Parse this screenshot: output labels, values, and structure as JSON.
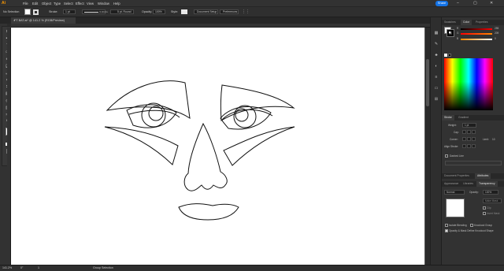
{
  "app": {
    "logo_text": "Ai"
  },
  "menu": [
    "File",
    "Edit",
    "Object",
    "Type",
    "Select",
    "Effect",
    "View",
    "Window",
    "Help"
  ],
  "share_label": "Share",
  "control_bar": {
    "selection": "No Selection",
    "stroke_label": "Stroke:",
    "stroke_value": "1 pt",
    "profile_label": "Uniform",
    "brush_label": "5 pt. Round",
    "opacity_label": "Opacity:",
    "opacity_value": "100%",
    "style_label": "Style:",
    "doc_setup": "Document Setup",
    "preferences": "Preferences"
  },
  "document_tab": {
    "title": "FT BAT.ai* @ 141.2 % (RGB/Preview)",
    "close": "×"
  },
  "status": {
    "zoom": "141.2%",
    "rotation": "0°",
    "artboard": "1",
    "mode": "Group Selection"
  },
  "panels": {
    "top_tabs": [
      "Swatches",
      "Color",
      "Properties"
    ],
    "active_top_tab": "Color",
    "color": {
      "r_label": "R",
      "r_value": "255",
      "g_label": "G",
      "g_value": "209",
      "b_label": "B",
      "b_value": "0",
      "hex_prefix": "#"
    },
    "stroke_tabs": [
      "Stroke",
      "Gradient"
    ],
    "stroke": {
      "weight_label": "Weight:",
      "weight_value": "1 pt",
      "cap_label": "Cap:",
      "corner_label": "Corner:",
      "limit_label": "Limit:",
      "limit_value": "10",
      "align_label": "Align Stroke:",
      "dashed_label": "Dashed Line"
    },
    "mid_tabs": [
      "Appearance",
      "Libraries"
    ],
    "mid_tabs_row2": [
      "Document Properties",
      "Attributes"
    ],
    "trans_tabs": [
      "Appearance",
      "Libraries",
      "Transparency"
    ],
    "transparency": {
      "mode": "Normal",
      "opacity_label": "Opacity:",
      "opacity_value": "100%",
      "make_mask": "Make Mask",
      "clip": "Clip",
      "invert": "Invert Mask",
      "isolate": "Isolate Blending",
      "knockout": "Knockout Group",
      "opacity_mask": "Opacity & Mask Define Knockout Shape"
    }
  },
  "tools": [
    "selection-tool",
    "direct-selection-tool",
    "pen-tool",
    "curvature-tool",
    "type-tool",
    "line-tool",
    "rectangle-tool",
    "paintbrush-tool",
    "shaper-tool",
    "pencil-tool",
    "eraser-tool",
    "rotate-tool",
    "scale-tool",
    "width-tool",
    "free-transform-tool",
    "shape-builder-tool",
    "perspective-tool",
    "mesh-tool",
    "gradient-tool",
    "eyedropper-tool",
    "blend-tool",
    "symbol-sprayer-tool",
    "column-graph-tool",
    "artboard-tool",
    "slice-tool",
    "hand-tool",
    "zoom-tool"
  ],
  "colors": {
    "fill": "#ffffff",
    "stroke": "#000000",
    "accent": "#1473e6",
    "logo": "#ff9a00",
    "art_stroke": "#111111"
  }
}
